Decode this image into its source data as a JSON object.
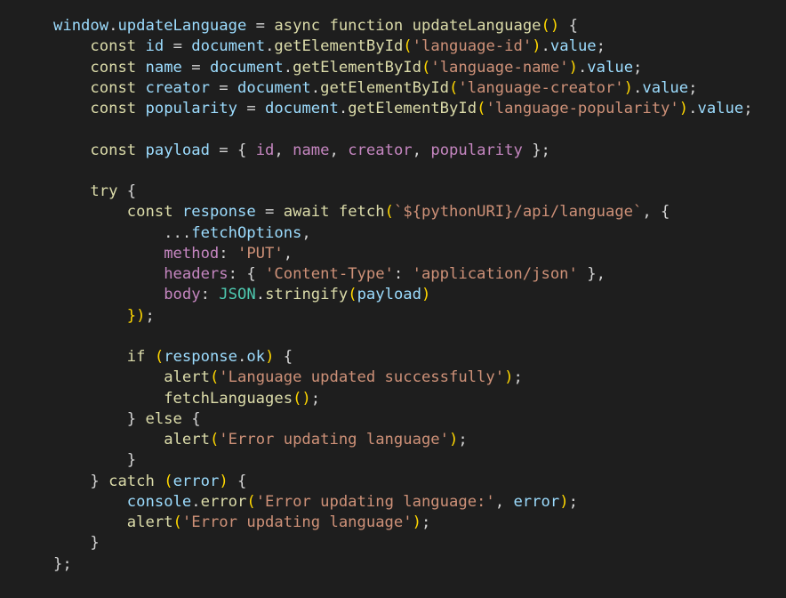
{
  "editor": {
    "background": "#1e1e1e",
    "language": "javascript",
    "colors": {
      "plain": "#d4d4d4",
      "keyword": "#dcdcaa",
      "control": "#c586c0",
      "function": "#dcdcaa",
      "variable": "#9cdcfe",
      "property": "#9cdcfe",
      "string": "#ce9178",
      "class": "#4ec9b0",
      "bracket": "#ffd700"
    },
    "lines": [
      [
        [
          "t-var",
          "window"
        ],
        [
          "t-punct",
          "."
        ],
        [
          "t-prop",
          "updateLanguage"
        ],
        [
          "t-punct",
          " = "
        ],
        [
          "t-keyword",
          "async"
        ],
        [
          "t-punct",
          " "
        ],
        [
          "t-keyword",
          "function"
        ],
        [
          "t-punct",
          " "
        ],
        [
          "t-func",
          "updateLanguage"
        ],
        [
          "t-paren",
          "()"
        ],
        [
          "t-punct",
          " {"
        ]
      ],
      [
        [
          "t-punct",
          "    "
        ],
        [
          "t-keyword",
          "const"
        ],
        [
          "t-punct",
          " "
        ],
        [
          "t-var",
          "id"
        ],
        [
          "t-punct",
          " = "
        ],
        [
          "t-var",
          "document"
        ],
        [
          "t-punct",
          "."
        ],
        [
          "t-func",
          "getElementById"
        ],
        [
          "t-paren",
          "("
        ],
        [
          "t-string",
          "'language-id'"
        ],
        [
          "t-paren",
          ")"
        ],
        [
          "t-punct",
          "."
        ],
        [
          "t-prop",
          "value"
        ],
        [
          "t-punct",
          ";"
        ]
      ],
      [
        [
          "t-punct",
          "    "
        ],
        [
          "t-keyword",
          "const"
        ],
        [
          "t-punct",
          " "
        ],
        [
          "t-var",
          "name"
        ],
        [
          "t-punct",
          " = "
        ],
        [
          "t-var",
          "document"
        ],
        [
          "t-punct",
          "."
        ],
        [
          "t-func",
          "getElementById"
        ],
        [
          "t-paren",
          "("
        ],
        [
          "t-string",
          "'language-name'"
        ],
        [
          "t-paren",
          ")"
        ],
        [
          "t-punct",
          "."
        ],
        [
          "t-prop",
          "value"
        ],
        [
          "t-punct",
          ";"
        ]
      ],
      [
        [
          "t-punct",
          "    "
        ],
        [
          "t-keyword",
          "const"
        ],
        [
          "t-punct",
          " "
        ],
        [
          "t-var",
          "creator"
        ],
        [
          "t-punct",
          " = "
        ],
        [
          "t-var",
          "document"
        ],
        [
          "t-punct",
          "."
        ],
        [
          "t-func",
          "getElementById"
        ],
        [
          "t-paren",
          "("
        ],
        [
          "t-string",
          "'language-creator'"
        ],
        [
          "t-paren",
          ")"
        ],
        [
          "t-punct",
          "."
        ],
        [
          "t-prop",
          "value"
        ],
        [
          "t-punct",
          ";"
        ]
      ],
      [
        [
          "t-punct",
          "    "
        ],
        [
          "t-keyword",
          "const"
        ],
        [
          "t-punct",
          " "
        ],
        [
          "t-var",
          "popularity"
        ],
        [
          "t-punct",
          " = "
        ],
        [
          "t-var",
          "document"
        ],
        [
          "t-punct",
          "."
        ],
        [
          "t-func",
          "getElementById"
        ],
        [
          "t-paren",
          "("
        ],
        [
          "t-string",
          "'language-popularity'"
        ],
        [
          "t-paren",
          ")"
        ],
        [
          "t-punct",
          "."
        ],
        [
          "t-prop",
          "value"
        ],
        [
          "t-punct",
          ";"
        ]
      ],
      [],
      [
        [
          "t-punct",
          "    "
        ],
        [
          "t-keyword",
          "const"
        ],
        [
          "t-punct",
          " "
        ],
        [
          "t-var",
          "payload"
        ],
        [
          "t-punct",
          " = { "
        ],
        [
          "t-control",
          "id"
        ],
        [
          "t-punct",
          ", "
        ],
        [
          "t-control",
          "name"
        ],
        [
          "t-punct",
          ", "
        ],
        [
          "t-control",
          "creator"
        ],
        [
          "t-punct",
          ", "
        ],
        [
          "t-control",
          "popularity"
        ],
        [
          "t-punct",
          " };"
        ]
      ],
      [],
      [
        [
          "t-punct",
          "    "
        ],
        [
          "t-keyword",
          "try"
        ],
        [
          "t-punct",
          " {"
        ]
      ],
      [
        [
          "t-punct",
          "        "
        ],
        [
          "t-keyword",
          "const"
        ],
        [
          "t-punct",
          " "
        ],
        [
          "t-var",
          "response"
        ],
        [
          "t-punct",
          " = "
        ],
        [
          "t-keyword",
          "await"
        ],
        [
          "t-punct",
          " "
        ],
        [
          "t-func",
          "fetch"
        ],
        [
          "t-paren",
          "("
        ],
        [
          "t-string",
          "`${pythonURI}/api/language`"
        ],
        [
          "t-punct",
          ", {"
        ]
      ],
      [
        [
          "t-punct",
          "            ..."
        ],
        [
          "t-var",
          "fetchOptions"
        ],
        [
          "t-punct",
          ","
        ]
      ],
      [
        [
          "t-punct",
          "            "
        ],
        [
          "t-control",
          "method"
        ],
        [
          "t-punct",
          ": "
        ],
        [
          "t-string",
          "'PUT'"
        ],
        [
          "t-punct",
          ","
        ]
      ],
      [
        [
          "t-punct",
          "            "
        ],
        [
          "t-control",
          "headers"
        ],
        [
          "t-punct",
          ": { "
        ],
        [
          "t-string",
          "'Content-Type'"
        ],
        [
          "t-punct",
          ": "
        ],
        [
          "t-string",
          "'application/json'"
        ],
        [
          "t-punct",
          " },"
        ]
      ],
      [
        [
          "t-punct",
          "            "
        ],
        [
          "t-control",
          "body"
        ],
        [
          "t-punct",
          ": "
        ],
        [
          "t-class",
          "JSON"
        ],
        [
          "t-punct",
          "."
        ],
        [
          "t-func",
          "stringify"
        ],
        [
          "t-paren",
          "("
        ],
        [
          "t-var",
          "payload"
        ],
        [
          "t-paren",
          ")"
        ]
      ],
      [
        [
          "t-punct",
          "        "
        ],
        [
          "t-paren",
          "})"
        ],
        [
          "t-punct",
          ";"
        ]
      ],
      [],
      [
        [
          "t-punct",
          "        "
        ],
        [
          "t-keyword",
          "if"
        ],
        [
          "t-punct",
          " "
        ],
        [
          "t-paren",
          "("
        ],
        [
          "t-var",
          "response"
        ],
        [
          "t-punct",
          "."
        ],
        [
          "t-prop",
          "ok"
        ],
        [
          "t-paren",
          ")"
        ],
        [
          "t-punct",
          " {"
        ]
      ],
      [
        [
          "t-punct",
          "            "
        ],
        [
          "t-func",
          "alert"
        ],
        [
          "t-paren",
          "("
        ],
        [
          "t-string",
          "'Language updated successfully'"
        ],
        [
          "t-paren",
          ")"
        ],
        [
          "t-punct",
          ";"
        ]
      ],
      [
        [
          "t-punct",
          "            "
        ],
        [
          "t-func",
          "fetchLanguages"
        ],
        [
          "t-paren",
          "()"
        ],
        [
          "t-punct",
          ";"
        ]
      ],
      [
        [
          "t-punct",
          "        } "
        ],
        [
          "t-keyword",
          "else"
        ],
        [
          "t-punct",
          " {"
        ]
      ],
      [
        [
          "t-punct",
          "            "
        ],
        [
          "t-func",
          "alert"
        ],
        [
          "t-paren",
          "("
        ],
        [
          "t-string",
          "'Error updating language'"
        ],
        [
          "t-paren",
          ")"
        ],
        [
          "t-punct",
          ";"
        ]
      ],
      [
        [
          "t-punct",
          "        }"
        ]
      ],
      [
        [
          "t-punct",
          "    } "
        ],
        [
          "t-keyword",
          "catch"
        ],
        [
          "t-punct",
          " "
        ],
        [
          "t-paren",
          "("
        ],
        [
          "t-var",
          "error"
        ],
        [
          "t-paren",
          ")"
        ],
        [
          "t-punct",
          " {"
        ]
      ],
      [
        [
          "t-punct",
          "        "
        ],
        [
          "t-var",
          "console"
        ],
        [
          "t-punct",
          "."
        ],
        [
          "t-func",
          "error"
        ],
        [
          "t-paren",
          "("
        ],
        [
          "t-string",
          "'Error updating language:'"
        ],
        [
          "t-punct",
          ", "
        ],
        [
          "t-var",
          "error"
        ],
        [
          "t-paren",
          ")"
        ],
        [
          "t-punct",
          ";"
        ]
      ],
      [
        [
          "t-punct",
          "        "
        ],
        [
          "t-func",
          "alert"
        ],
        [
          "t-paren",
          "("
        ],
        [
          "t-string",
          "'Error updating language'"
        ],
        [
          "t-paren",
          ")"
        ],
        [
          "t-punct",
          ";"
        ]
      ],
      [
        [
          "t-punct",
          "    }"
        ]
      ],
      [
        [
          "t-punct",
          "};"
        ]
      ]
    ]
  }
}
